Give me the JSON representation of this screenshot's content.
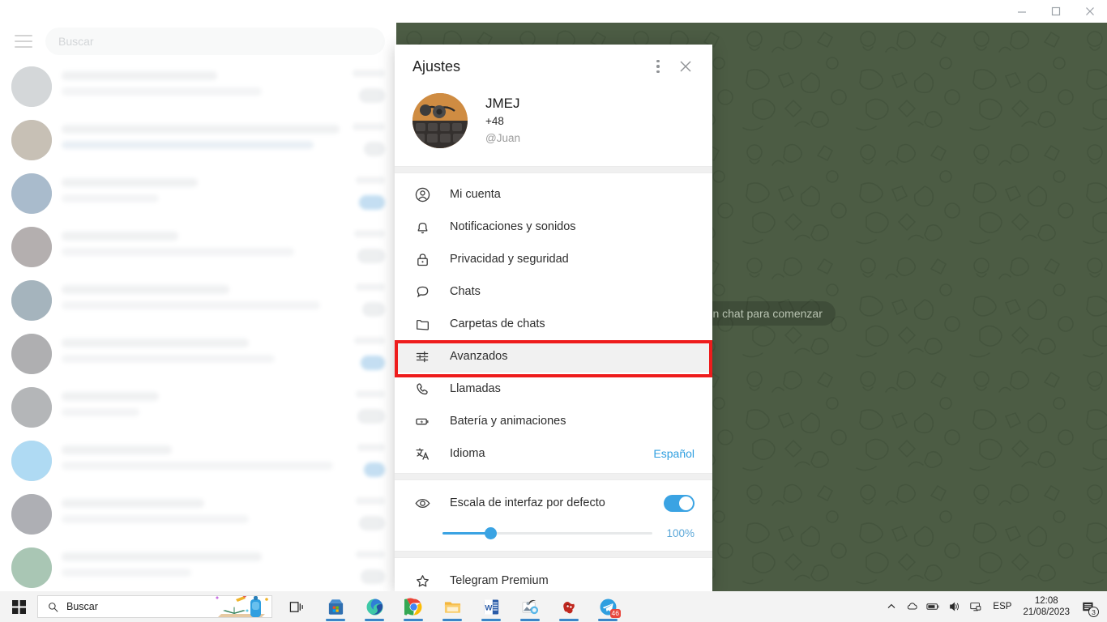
{
  "window": {
    "minimize_label": "Minimizar",
    "maximize_label": "Maximizar",
    "close_label": "Cerrar"
  },
  "chat_column": {
    "search_placeholder": "Buscar",
    "menu_label": "Menú"
  },
  "right_pane": {
    "empty_state": "a un chat para comenzar",
    "background_color": "#4c5c44"
  },
  "dialog": {
    "title": "Ajustes",
    "profile": {
      "name": "JMEJ",
      "phone": "+48",
      "username": "@Juan"
    },
    "menu": [
      {
        "icon": "account-circle-icon",
        "label": "Mi cuenta",
        "value": ""
      },
      {
        "icon": "bell-icon",
        "label": "Notificaciones y sonidos",
        "value": ""
      },
      {
        "icon": "lock-icon",
        "label": "Privacidad y seguridad",
        "value": ""
      },
      {
        "icon": "chat-bubble-icon",
        "label": "Chats",
        "value": ""
      },
      {
        "icon": "folder-icon",
        "label": "Carpetas de chats",
        "value": ""
      },
      {
        "icon": "sliders-icon",
        "label": "Avanzados",
        "value": ""
      },
      {
        "icon": "phone-icon",
        "label": "Llamadas",
        "value": ""
      },
      {
        "icon": "battery-icon",
        "label": "Batería y animaciones",
        "value": ""
      },
      {
        "icon": "translate-icon",
        "label": "Idioma",
        "value": "Español"
      }
    ],
    "highlighted_item": "Avanzados",
    "highlight_color": "#ee1c1c",
    "scale": {
      "icon": "eye-icon",
      "label": "Escala de interfaz por defecto",
      "toggle_on": true,
      "value": "100%",
      "slider_percent": 23,
      "accent_color": "#3aa3e3"
    },
    "premium": {
      "icon": "star-icon",
      "label": "Telegram Premium"
    }
  },
  "taskbar": {
    "start_label": "Inicio",
    "search_placeholder": "Buscar",
    "apps": [
      {
        "name": "task-view",
        "label": "Vista de tareas"
      },
      {
        "name": "microsoft-store",
        "label": "Microsoft Store"
      },
      {
        "name": "microsoft-edge",
        "label": "Microsoft Edge"
      },
      {
        "name": "google-chrome",
        "label": "Google Chrome"
      },
      {
        "name": "file-explorer",
        "label": "Explorador de archivos"
      },
      {
        "name": "microsoft-word",
        "label": "Word"
      },
      {
        "name": "photos-app",
        "label": "Fotos"
      },
      {
        "name": "gimp-app",
        "label": "GIMP"
      },
      {
        "name": "telegram",
        "label": "Telegram",
        "badge": "46"
      }
    ],
    "tray": {
      "language": "ESP",
      "time": "12:08",
      "date": "21/08/2023",
      "notification_count": "3"
    }
  }
}
